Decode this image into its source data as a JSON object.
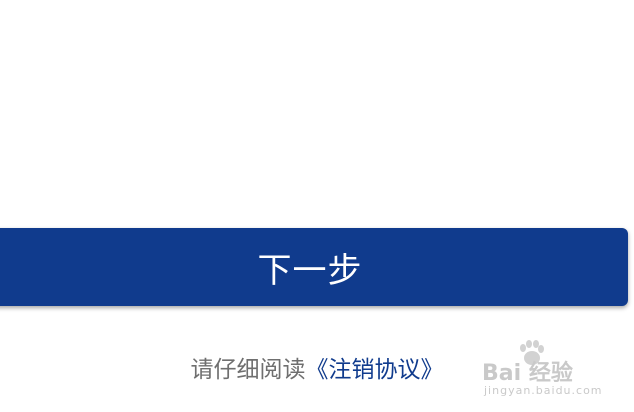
{
  "primary_action": {
    "label": "下一步",
    "color": "#103b8d"
  },
  "agreement": {
    "prefix": "请仔细阅读",
    "link_text": "《注销协议》"
  },
  "watermark": {
    "logo": "Bai 经验",
    "url": "jingyan.baidu.com",
    "icon": "paw-icon"
  }
}
